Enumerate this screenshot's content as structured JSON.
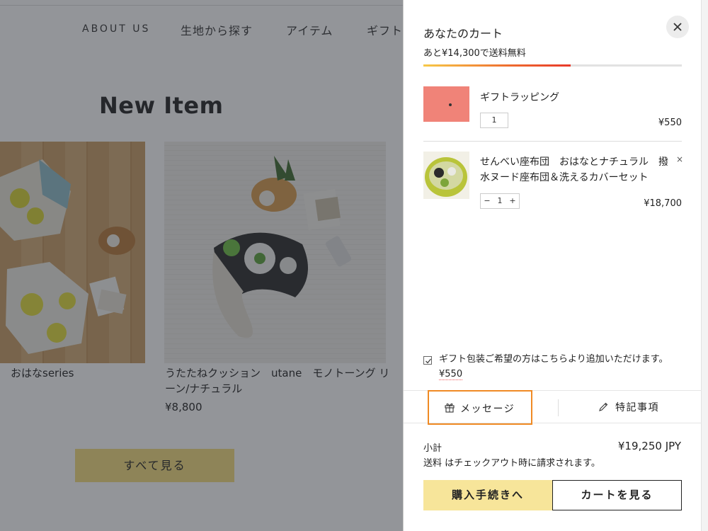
{
  "nav": {
    "items": [
      "ABOUT US",
      "生地から探す",
      "アイテム",
      "ギフト"
    ]
  },
  "main": {
    "title": "New Item",
    "products": [
      {
        "name": "おはなseries",
        "price": ""
      },
      {
        "name": "うたたねクッション　utane　モノトーング リーン/ナチュラル",
        "price": "¥8,800"
      }
    ],
    "view_all_label": "すべて見る"
  },
  "cart": {
    "title": "あなたのカート",
    "free_shipping": "あと¥14,300で送料無料",
    "free_shipping_progress": 0.57,
    "items": [
      {
        "name": "ギフトラッピング",
        "qty": "1",
        "price": "¥550",
        "thumb_color": "#f08378"
      },
      {
        "name": "せんべい座布団　おはなとナチュラル　撥水ヌード座布団＆洗えるカバーセット",
        "qty": "1",
        "minus": "−",
        "plus": "+",
        "price": "¥18,700",
        "remove": "×"
      }
    ],
    "gift_option": {
      "text": "ギフト包装ご希望の方はこちらより追加いただけます。",
      "price": "¥550",
      "checked": true
    },
    "message_label": "メッセージ",
    "notes_label": "特記事項",
    "subtotal_label": "小計",
    "subtotal_value": "¥19,250 JPY",
    "shipping_note": "送料 はチェックアウト時に請求されます。",
    "checkout_label": "購入手続きへ",
    "view_cart_label": "カートを見る"
  },
  "colors": {
    "accent_yellow": "#f4dd7c",
    "highlight_orange": "#f08a24",
    "overlay": "rgba(40,44,52,0.5)"
  }
}
